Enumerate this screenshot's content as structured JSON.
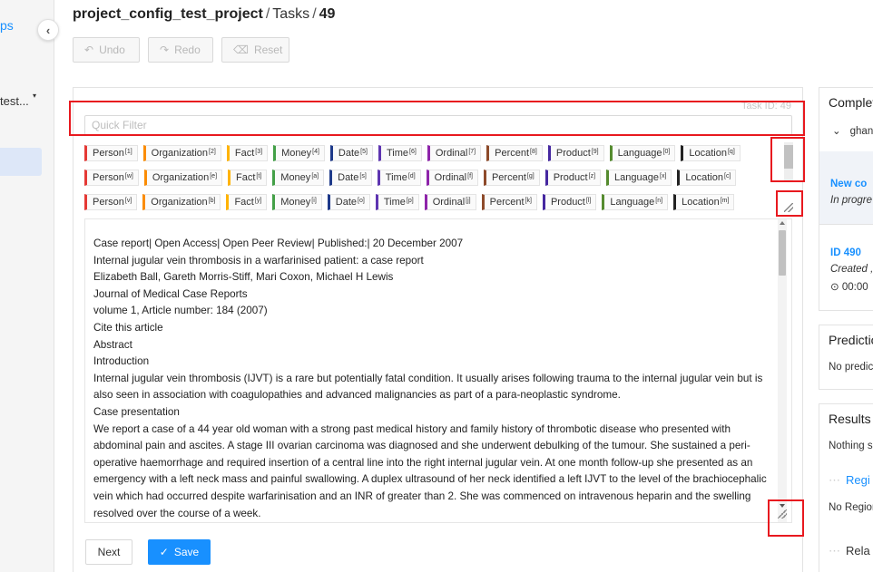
{
  "sidebar": {
    "brand_fragment": "ps",
    "project_fragment": "test...",
    "caret": "▾",
    "collapse_icon": "‹"
  },
  "breadcrumb": {
    "project": "project_config_test_project",
    "sep": "/",
    "tasks": "Tasks",
    "task_id": "49"
  },
  "toolbar": {
    "undo": "Undo",
    "redo": "Redo",
    "reset": "Reset"
  },
  "task_id_label": "Task ID: 49",
  "filter_placeholder": "Quick Filter",
  "label_rows": [
    [
      {
        "text": "Person",
        "key": "1",
        "color": "#e53935"
      },
      {
        "text": "Organization",
        "key": "2",
        "color": "#fb8c00"
      },
      {
        "text": "Fact",
        "key": "3",
        "color": "#ffb300"
      },
      {
        "text": "Money",
        "key": "4",
        "color": "#43a047"
      },
      {
        "text": "Date",
        "key": "5",
        "color": "#1e3a8a"
      },
      {
        "text": "Time",
        "key": "6",
        "color": "#5e35b1"
      },
      {
        "text": "Ordinal",
        "key": "7",
        "color": "#8e24aa"
      },
      {
        "text": "Percent",
        "key": "8",
        "color": "#8d4a2a"
      },
      {
        "text": "Product",
        "key": "9",
        "color": "#4527a0"
      },
      {
        "text": "Language",
        "key": "0",
        "color": "#558b2f"
      },
      {
        "text": "Location",
        "key": "q",
        "color": "#222222"
      }
    ],
    [
      {
        "text": "Person",
        "key": "w",
        "color": "#e53935"
      },
      {
        "text": "Organization",
        "key": "e",
        "color": "#fb8c00"
      },
      {
        "text": "Fact",
        "key": "t",
        "color": "#ffb300"
      },
      {
        "text": "Money",
        "key": "a",
        "color": "#43a047"
      },
      {
        "text": "Date",
        "key": "s",
        "color": "#1e3a8a"
      },
      {
        "text": "Time",
        "key": "d",
        "color": "#5e35b1"
      },
      {
        "text": "Ordinal",
        "key": "f",
        "color": "#8e24aa"
      },
      {
        "text": "Percent",
        "key": "g",
        "color": "#8d4a2a"
      },
      {
        "text": "Product",
        "key": "z",
        "color": "#4527a0"
      },
      {
        "text": "Language",
        "key": "x",
        "color": "#558b2f"
      },
      {
        "text": "Location",
        "key": "c",
        "color": "#222222"
      }
    ],
    [
      {
        "text": "Person",
        "key": "v",
        "color": "#e53935"
      },
      {
        "text": "Organization",
        "key": "b",
        "color": "#fb8c00"
      },
      {
        "text": "Fact",
        "key": "y",
        "color": "#ffb300"
      },
      {
        "text": "Money",
        "key": "i",
        "color": "#43a047"
      },
      {
        "text": "Date",
        "key": "o",
        "color": "#1e3a8a"
      },
      {
        "text": "Time",
        "key": "p",
        "color": "#5e35b1"
      },
      {
        "text": "Ordinal",
        "key": "j",
        "color": "#8e24aa"
      },
      {
        "text": "Percent",
        "key": "k",
        "color": "#8d4a2a"
      },
      {
        "text": "Product",
        "key": "l",
        "color": "#4527a0"
      },
      {
        "text": "Language",
        "key": "n",
        "color": "#558b2f"
      },
      {
        "text": "Location",
        "key": "m",
        "color": "#222222"
      }
    ]
  ],
  "document_lines": [
    "Case report| Open Access| Open Peer Review| Published:| 20 December 2007",
    "Internal jugular vein thrombosis in a warfarinised patient: a case report",
    "Elizabeth Ball, Gareth Morris-Stiff, Mari Coxon, Michael H Lewis",
    "Journal of Medical Case Reports",
    "volume 1, Article number: 184 (2007)",
    "Cite this article",
    "Abstract",
    "Introduction",
    "Internal jugular vein thrombosis (IJVT) is a rare but potentially fatal condition. It usually arises following trauma to the internal jugular vein but is",
    "also seen in association with coagulopathies and advanced malignancies as part of a para-neoplastic syndrome.",
    "Case presentation",
    "We report a case of a 44 year old woman with a strong past medical history and family history of thrombotic disease who presented with",
    "abdominal pain and ascites. A stage III ovarian carcinoma was diagnosed and she underwent debulking of the tumour. She sustained a peri-",
    "operative haemorrhage and required insertion of a central line into the right internal jugular vein. At one month follow-up she presented as an",
    "emergency with a left neck mass and painful swallowing. A duplex ultrasound of her neck identified a left IJVT to the level of the brachiocephalic",
    "vein which had occurred despite warfarinisation and an INR of greater than 2. She was commenced on intravenous heparin and the swelling",
    "resolved over the course of a week."
  ],
  "buttons": {
    "next": "Next",
    "save": "Save",
    "save_icon": "✓"
  },
  "right_panel": {
    "completions_title": "Complet",
    "annotator_chevron": "⌄",
    "annotator": "ghan",
    "new_completion": "New co",
    "in_progress": "In progre",
    "completion_id": "ID 490",
    "created": "Created ,",
    "time": "00:00",
    "predictions_title": "Predictio",
    "no_predictions": "No predic",
    "results_title": "Results",
    "nothing_selected": "Nothing s",
    "regions": "Regi",
    "no_regions": "No Region",
    "relations": "Rela"
  },
  "colors": {
    "accent": "#1890ff",
    "highlight": "#e8191f"
  }
}
